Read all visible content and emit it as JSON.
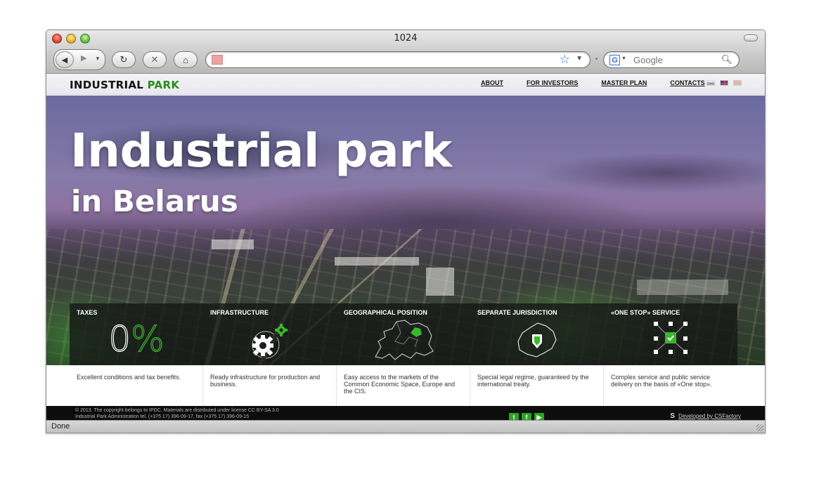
{
  "window": {
    "title": "1024"
  },
  "toolbar": {
    "url": "",
    "search_placeholder": "Google",
    "search_engine_glyph": "G"
  },
  "site": {
    "logo_main": "INDUSTRIAL",
    "logo_accent": "PARK",
    "nav": [
      "ABOUT",
      "FOR INVESTORS",
      "MASTER PLAN",
      "CONTACTS"
    ],
    "languages": [
      "ru",
      "en",
      "by"
    ]
  },
  "hero": {
    "title": "Industrial park",
    "subtitle": "in Belarus"
  },
  "features": [
    {
      "title": "TAXES",
      "icon": "zero-percent-icon",
      "value_main": "0",
      "value_sign": "%",
      "description": "Excellent conditions and tax benefits."
    },
    {
      "title": "INFRASTRUCTURE",
      "icon": "gears-icon",
      "description": "Ready infrastructure for production and business."
    },
    {
      "title": "GEOGRAPHICAL POSITION",
      "icon": "europe-map-icon",
      "description": "Easy access to the markets of the Common Economic Space, Europe and the CIS."
    },
    {
      "title": "SEPARATE JURISDICTION",
      "icon": "belarus-shield-icon",
      "description": "Special legal regime, guaranteed by the international treaty."
    },
    {
      "title": "«ONE STOP» SERVICE",
      "icon": "one-stop-check-icon",
      "description": "Complex service and public service delivery on the basis of «One stop»."
    }
  ],
  "footer": {
    "copyright": "© 2013. The copyright belongs to IPDC. Materials are distributed under license CC BY-SA 3.0",
    "admin": "Industrial Park Administration tel. (+375 17) 396-09-17, fax (+375 17) 396-09-15",
    "social": [
      "twitter",
      "facebook",
      "youtube"
    ],
    "developer": "Developed by CSFactory"
  },
  "status": {
    "text": "Done"
  },
  "colors": {
    "accent_green": "#2a8c1f",
    "icon_green": "#39b82c",
    "footer_bg": "#0d0d0d"
  }
}
